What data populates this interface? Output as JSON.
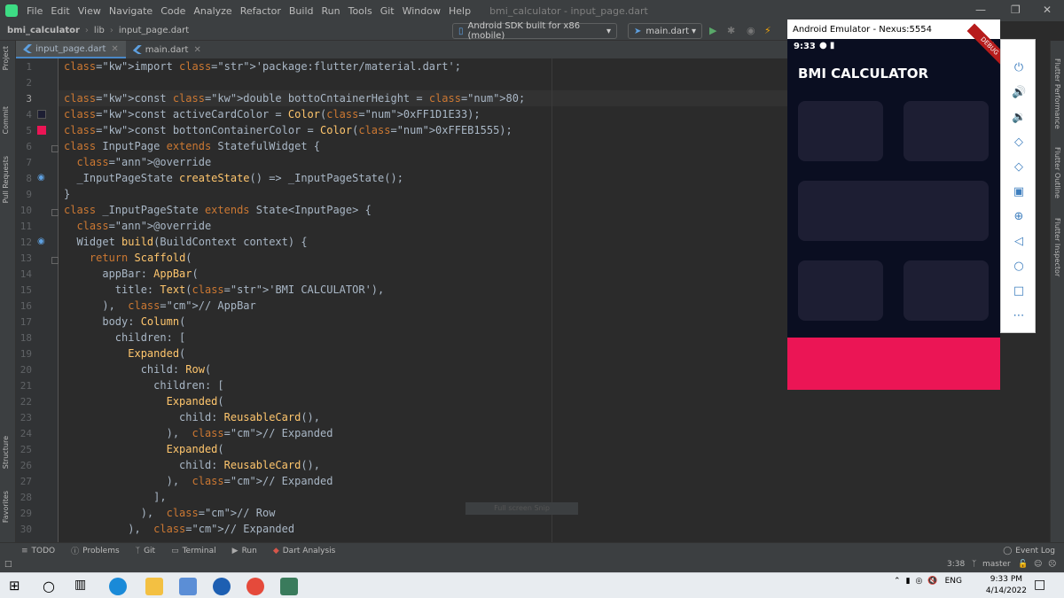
{
  "menubar": {
    "items": [
      "File",
      "Edit",
      "View",
      "Navigate",
      "Code",
      "Analyze",
      "Refactor",
      "Build",
      "Run",
      "Tools",
      "Git",
      "Window",
      "Help"
    ],
    "window_title": "bmi_calculator - input_page.dart"
  },
  "navbar": {
    "project": "bmi_calculator",
    "folder": "lib",
    "file": "input_page.dart",
    "device": "Android SDK built for x86 (mobile)",
    "run_config": "main.dart"
  },
  "tabs": [
    {
      "label": "input_page.dart",
      "active": true
    },
    {
      "label": "main.dart",
      "active": false
    }
  ],
  "left_tools": [
    "Project",
    "Commit",
    "Pull Requests",
    "Structure",
    "Favorites"
  ],
  "right_tools": [
    "Flutter Performance",
    "Flutter Outline",
    "Flutter Inspector"
  ],
  "code": {
    "line_numbers": [
      "1",
      "2",
      "3",
      "4",
      "5",
      "6",
      "7",
      "8",
      "9",
      "10",
      "11",
      "12",
      "13",
      "14",
      "15",
      "16",
      "17",
      "18",
      "19",
      "20",
      "21",
      "22",
      "23",
      "24",
      "25",
      "26",
      "27",
      "28",
      "29",
      "30"
    ],
    "lines": [
      "import 'package:flutter/material.dart';",
      "",
      "const double bottoCntainerHeight = 80;",
      "const activeCardColor = Color(0xFF1D1E33);",
      "const bottonContainerColor = Color(0xFFEB1555);",
      "class InputPage extends StatefulWidget {",
      "  @override",
      "  _InputPageState createState() => _InputPageState();",
      "}",
      "class _InputPageState extends State<InputPage> {",
      "  @override",
      "  Widget build(BuildContext context) {",
      "    return Scaffold(",
      "      appBar: AppBar(",
      "        title: Text('BMI CALCULATOR'),",
      "      ),  // AppBar",
      "      body: Column(",
      "        children: [",
      "          Expanded(",
      "            child: Row(",
      "              children: [",
      "                Expanded(",
      "                  child: ReusableCard(),",
      "                ),  // Expanded",
      "                Expanded(",
      "                  child: ReusableCard(),",
      "                ),  // Expanded",
      "              ],",
      "            ),  // Row",
      "          ),  // Expanded"
    ],
    "tooltip": "Full screen Snip"
  },
  "emulator": {
    "title": "Android Emulator - Nexus:5554",
    "time": "9:33",
    "app_title": "BMI CALCULATOR",
    "debug_banner": "DEBUG",
    "active_card_color": "#1D1E33",
    "bottom_color": "#EB1555",
    "background": "#0A0E21",
    "controls": [
      "power-icon",
      "volume-up-icon",
      "volume-down-icon",
      "rotate-left-icon",
      "rotate-right-icon",
      "camera-icon",
      "zoom-icon",
      "back-icon",
      "home-icon",
      "overview-icon",
      "more-icon"
    ]
  },
  "toolbar": {
    "items": [
      "TODO",
      "Problems",
      "Git",
      "Terminal",
      "Run",
      "Dart Analysis"
    ],
    "event_log": "Event Log"
  },
  "statusline": {
    "position": "3:38",
    "branch": "master"
  },
  "taskbar": {
    "lang": "ENG",
    "time": "9:33 PM",
    "date": "4/14/2022"
  }
}
